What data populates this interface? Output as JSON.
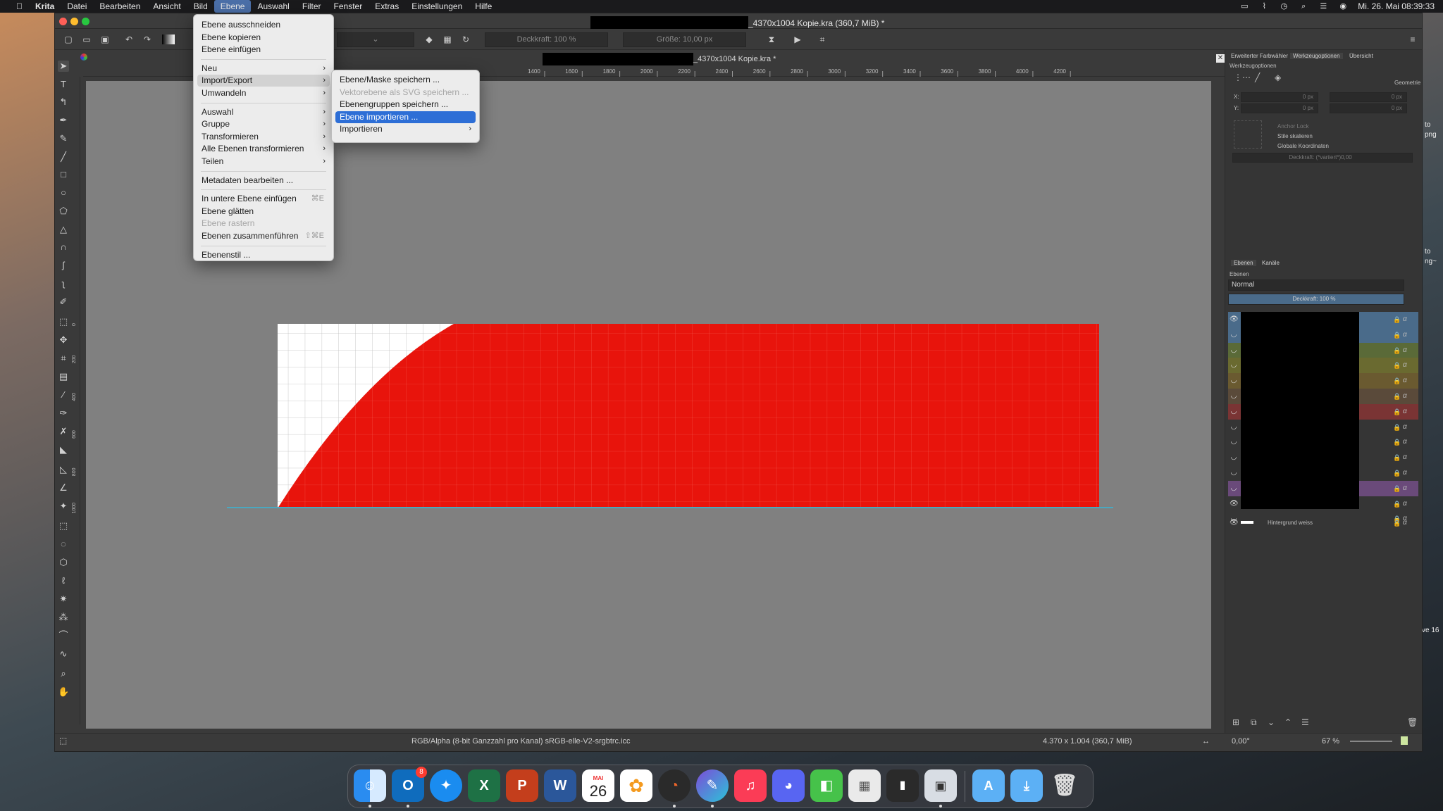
{
  "menubar": {
    "apple": "",
    "app_name": "Krita",
    "items": [
      "Datei",
      "Bearbeiten",
      "Ansicht",
      "Bild",
      "Ebene",
      "Auswahl",
      "Filter",
      "Fenster",
      "Extras",
      "Einstellungen",
      "Hilfe"
    ],
    "active_item": "Ebene",
    "datetime": "Mi. 26. Mai  08:39:33"
  },
  "window": {
    "title_suffix": "_4370x1004 Kopie.kra (360,7 MiB)  *",
    "canvas_tab_suffix": "_4370x1004 Kopie.kra *"
  },
  "toolbar": {
    "opacity_label": "Deckkraft: 100 %",
    "size_label": "Größe: 10,00 px"
  },
  "ruler": {
    "top_ticks": [
      "1400",
      "1600",
      "1800",
      "2000",
      "2200",
      "2400",
      "2600",
      "2800",
      "3000",
      "3200",
      "3400",
      "3600",
      "3800",
      "4000",
      "4200"
    ],
    "left_ticks": [
      "0",
      "200",
      "400",
      "600",
      "800",
      "1000"
    ]
  },
  "ebene_menu": {
    "items": [
      {
        "label": "Ebene ausschneiden"
      },
      {
        "label": "Ebene kopieren"
      },
      {
        "label": "Ebene einfügen"
      },
      {
        "label": "Neu",
        "submenu": true
      },
      {
        "label": "Import/Export",
        "submenu": true,
        "highlighted": true
      },
      {
        "label": "Umwandeln",
        "submenu": true
      },
      {
        "label": "Auswahl",
        "submenu": true
      },
      {
        "label": "Gruppe",
        "submenu": true
      },
      {
        "label": "Transformieren",
        "submenu": true
      },
      {
        "label": "Alle Ebenen transformieren",
        "submenu": true
      },
      {
        "label": "Teilen",
        "submenu": true
      },
      {
        "label": "Metadaten bearbeiten ..."
      },
      {
        "label": "In untere Ebene einfügen",
        "shortcut": "⌘E"
      },
      {
        "label": "Ebene glätten"
      },
      {
        "label": "Ebene rastern",
        "disabled": true
      },
      {
        "label": "Ebenen zusammenführen",
        "shortcut": "⇧⌘E"
      },
      {
        "label": "Ebenenstil ..."
      }
    ]
  },
  "import_export_menu": {
    "items": [
      {
        "label": "Ebene/Maske speichern ..."
      },
      {
        "label": "Vektorebene als SVG speichern ...",
        "disabled": true
      },
      {
        "label": "Ebenengruppen speichern ..."
      },
      {
        "label": "Ebene importieren ...",
        "selected": true
      },
      {
        "label": "Importieren",
        "submenu": true
      }
    ]
  },
  "statusbar": {
    "color_info": "RGB/Alpha (8-bit Ganzzahl pro Kanal)  sRGB-elle-V2-srgbtrc.icc",
    "dimensions": "4.370 x 1.004 (360,7 MiB)",
    "rotation": "0,00°",
    "zoom": "67 %"
  },
  "docker": {
    "top_tabs": [
      "Erweiterter Farbwähler",
      "Werkzeugoptionen",
      "Übersicht"
    ],
    "tool_options_title": "Werkzeugoptionen",
    "geometry_label": "Geometrie",
    "x_label": "X:",
    "y_label": "Y:",
    "zero_px": "0 px",
    "anchor_lock": "Anchor Lock",
    "scale_styles": "Stile skalieren",
    "global_coords": "Globale Koordinaten",
    "opacity_varies": "Deckkraft: (*variiert*)0,00",
    "layer_tabs": [
      "Ebenen",
      "Kanäle"
    ],
    "layers_title": "Ebenen",
    "blend_mode": "Normal",
    "layer_opacity": "Deckkraft:  100 %",
    "background_layer": "Hintergrund weiss"
  },
  "desktop_labels": [
    "to",
    "png",
    "to",
    "ng~",
    "ve 16"
  ],
  "dock": {
    "calendar_month": "MAI",
    "calendar_day": "26",
    "outlook_badge": "8"
  },
  "colors": {
    "accent": "#2d6ed6",
    "canvas_red": "#e8140c",
    "canvas_bg": "#808080",
    "guide": "#4aa8c0"
  }
}
